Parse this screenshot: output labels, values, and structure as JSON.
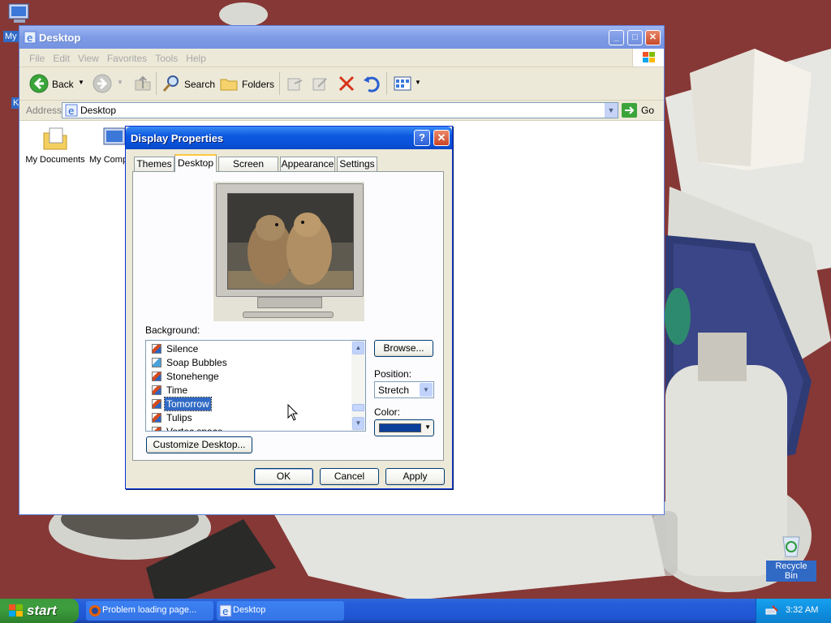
{
  "desktop": {
    "icons": [
      {
        "label": "My"
      },
      {
        "label": "K"
      },
      {
        "label": "Recycle Bin"
      }
    ]
  },
  "explorer": {
    "title": "Desktop",
    "menu": [
      "File",
      "Edit",
      "View",
      "Favorites",
      "Tools",
      "Help"
    ],
    "toolbar": {
      "back": "Back",
      "search": "Search",
      "folders": "Folders"
    },
    "address": {
      "label": "Address",
      "value": "Desktop",
      "go": "Go"
    },
    "items": [
      {
        "label": "My Documents",
        "icon": "folder-documents-icon"
      },
      {
        "label": "My Comp",
        "icon": "computer-icon"
      }
    ]
  },
  "dialog": {
    "title": "Display Properties",
    "tabs": [
      "Themes",
      "Desktop",
      "Screen Saver",
      "Appearance",
      "Settings"
    ],
    "active_tab": "Desktop",
    "background_label": "Background:",
    "backgrounds": [
      "Silence",
      "Soap Bubbles",
      "Stonehenge",
      "Time",
      "Tomorrow",
      "Tulips",
      "Vortec space"
    ],
    "selected_background": "Tomorrow",
    "browse": "Browse...",
    "position_label": "Position:",
    "position_value": "Stretch",
    "color_label": "Color:",
    "color_value": "#0a3f9c",
    "customize": "Customize Desktop...",
    "ok": "OK",
    "cancel": "Cancel",
    "apply": "Apply"
  },
  "taskbar": {
    "start": "start",
    "tasks": [
      "Problem loading page...",
      "Desktop"
    ],
    "clock": "3:32 AM"
  }
}
